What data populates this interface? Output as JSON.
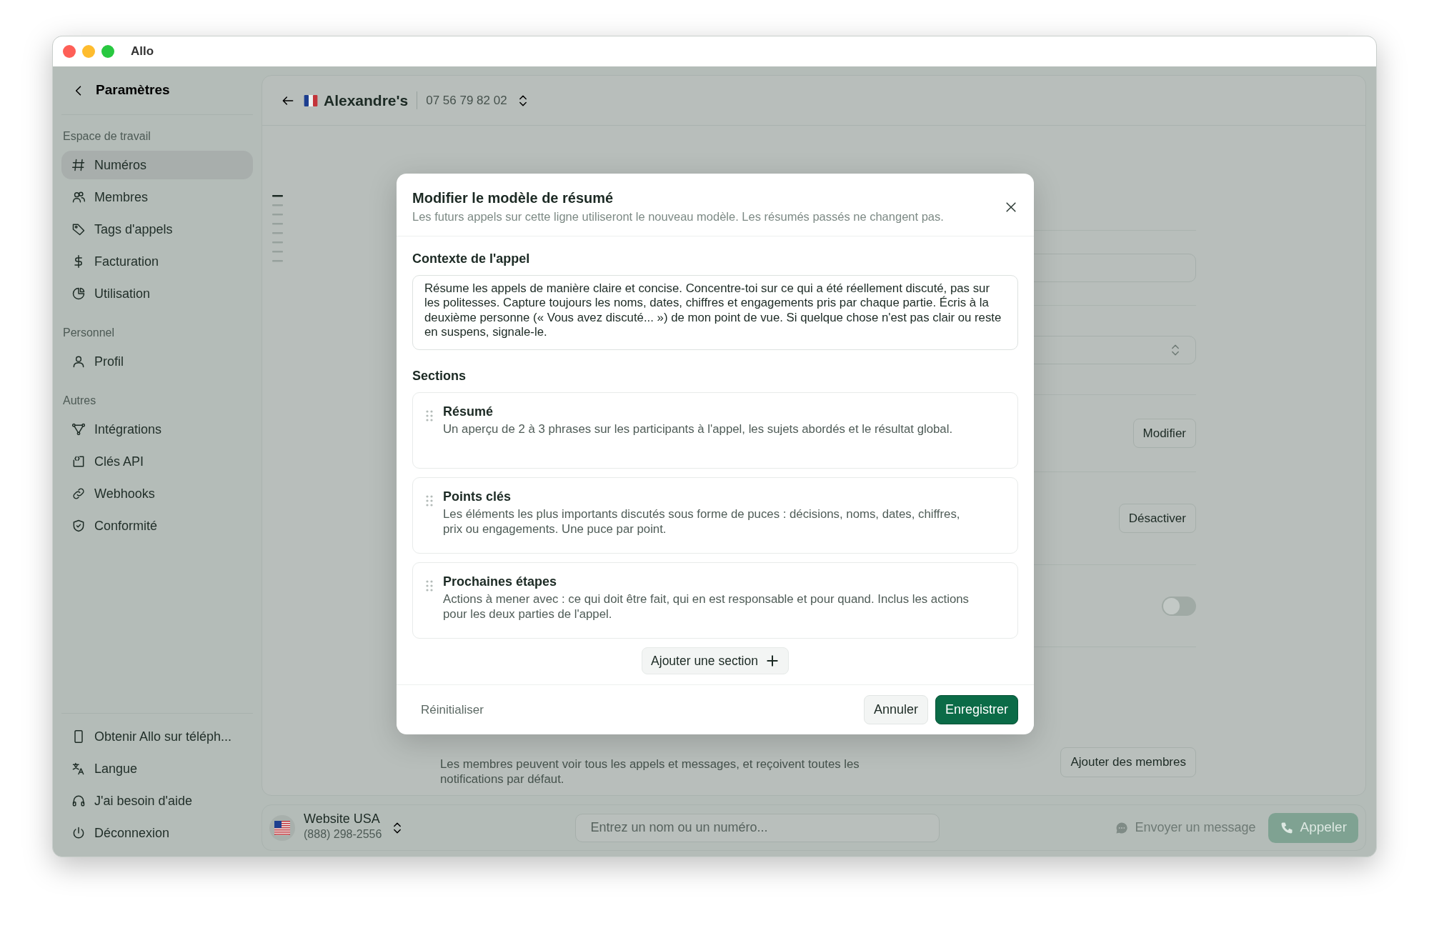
{
  "window": {
    "title": "Allo"
  },
  "sidebar": {
    "back_label": "Paramètres",
    "groups": [
      {
        "heading": "Espace de travail",
        "items": [
          {
            "label": "Numéros",
            "selected": true
          },
          {
            "label": "Membres",
            "selected": false
          },
          {
            "label": "Tags d'appels",
            "selected": false
          },
          {
            "label": "Facturation",
            "selected": false
          },
          {
            "label": "Utilisation",
            "selected": false
          }
        ]
      },
      {
        "heading": "Personnel",
        "items": [
          {
            "label": "Profil",
            "selected": false
          }
        ]
      },
      {
        "heading": "Autres",
        "items": [
          {
            "label": "Intégrations",
            "selected": false
          },
          {
            "label": "Clés API",
            "selected": false
          },
          {
            "label": "Webhooks",
            "selected": false
          },
          {
            "label": "Conformité",
            "selected": false
          }
        ]
      }
    ],
    "footer_items": [
      "Obtenir Allo sur téléph...",
      "Langue",
      "J'ai besoin d'aide",
      "Déconnexion"
    ]
  },
  "header": {
    "name": "Alexandre's",
    "phone": "07 56 79 82 02"
  },
  "settings_rows": [
    {
      "kind": "input"
    },
    {
      "kind": "select"
    },
    {
      "kind": "button",
      "label": "Modifier"
    },
    {
      "kind": "button",
      "label": "Désactiver"
    },
    {
      "kind": "toggle",
      "on": false
    },
    {
      "kind": "members",
      "note": "Les membres peuvent voir tous les appels et messages, et reçoivent toutes les notifications par défaut.",
      "label": "Ajouter des membres"
    }
  ],
  "modal": {
    "title": "Modifier le modèle de résumé",
    "subtitle": "Les futurs appels sur cette ligne utiliseront le nouveau modèle. Les résumés passés ne changent pas.",
    "context_label": "Contexte de l'appel",
    "context_text": "Résume les appels de manière claire et concise. Concentre-toi sur ce qui a été réellement discuté, pas sur les politesses. Capture toujours les noms, dates, chiffres et engagements pris par chaque partie. Écris à la deuxième personne (« Vous avez discuté... ») de mon point de vue. Si quelque chose n'est pas clair ou reste en suspens, signale-le.",
    "sections_label": "Sections",
    "sections": [
      {
        "title": "Résumé",
        "description": "Un aperçu de 2 à 3 phrases sur les participants à l'appel, les sujets abordés et le résultat global."
      },
      {
        "title": "Points clés",
        "description": "Les éléments les plus importants discutés sous forme de puces : décisions, noms, dates, chiffres, prix ou engagements. Une puce par point."
      },
      {
        "title": "Prochaines étapes",
        "description": "Actions à mener avec : ce qui doit être fait, qui en est responsable et pour quand. Inclus les actions pour les deux parties de l'appel."
      }
    ],
    "add_section": "Ajouter une section",
    "reset": "Réinitialiser",
    "cancel": "Annuler",
    "save": "Enregistrer"
  },
  "bottom_bar": {
    "line_name": "Website USA",
    "line_phone": "(888) 298-2556",
    "search": {
      "placeholder": "Entrez un nom ou un numéro..."
    },
    "message_button": "Envoyer un message",
    "call_button": "Appeler"
  }
}
